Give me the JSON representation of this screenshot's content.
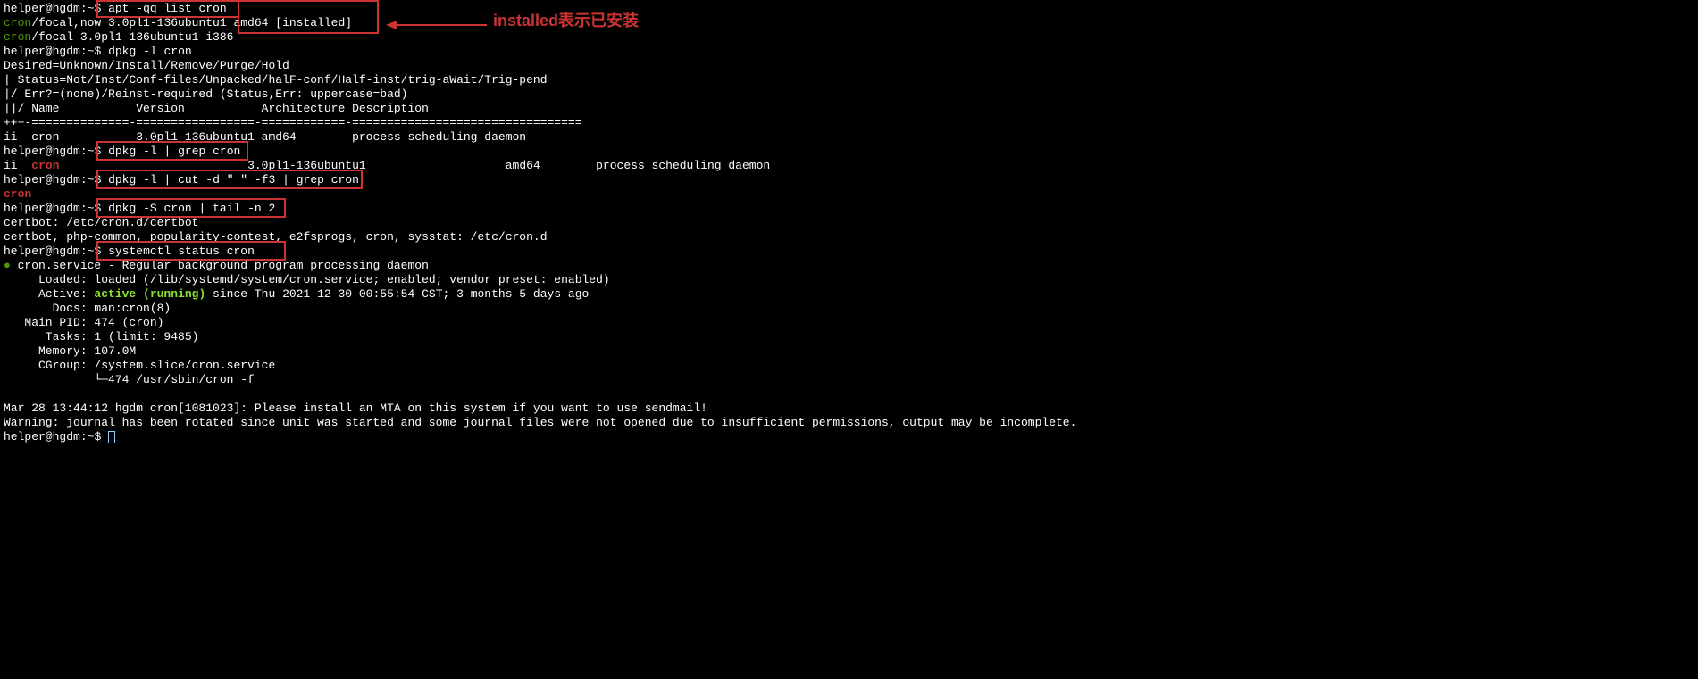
{
  "prompt": {
    "userhost": "helper@hgdm",
    "path": "~",
    "sep": ":",
    "dollar": "$"
  },
  "cmd": {
    "apt_list": "apt -qq list cron",
    "dpkg_l_cron": "dpkg -l cron",
    "dpkg_l_grep": "dpkg -l | grep cron",
    "dpkg_cut": "dpkg -l | cut -d \" \" -f3 | grep cron",
    "dpkg_S": "dpkg -S cron | tail -n 2",
    "systemctl": "systemctl status cron"
  },
  "apt": {
    "cron_focal_now": "cron",
    "focal_now_rest": "/focal,now 3.0pl1-136ubuntu1 amd64 [installed]",
    "cron_focal": "cron",
    "focal_rest": "/focal 3.0pl1-136ubuntu1 i386"
  },
  "dpkg_hdr": {
    "l1": "Desired=Unknown/Install/Remove/Purge/Hold",
    "l2": "| Status=Not/Inst/Conf-files/Unpacked/halF-conf/Half-inst/trig-aWait/Trig-pend",
    "l3": "|/ Err?=(none)/Reinst-required (Status,Err: uppercase=bad)",
    "l4": "||/ Name           Version           Architecture Description",
    "l5": "+++-==============-=================-============-=================================",
    "l6": "ii  cron           3.0pl1-136ubuntu1 amd64        process scheduling daemon"
  },
  "grep": {
    "ii": "ii  ",
    "cron": "cron",
    "rest": "                           3.0pl1-136ubuntu1                    amd64        process scheduling daemon"
  },
  "cut": {
    "cron": "cron"
  },
  "dpkgS": {
    "l1": "certbot: /etc/cron.d/certbot",
    "l2": "certbot, php-common, popularity-contest, e2fsprogs, cron, sysstat: /etc/cron.d"
  },
  "svc": {
    "bullet": "●",
    "name": " cron.service - Regular background program processing daemon",
    "loaded_label": "     Loaded: ",
    "loaded_val": "loaded (/lib/systemd/system/cron.service; enabled; vendor preset: enabled)",
    "active_label": "     Active: ",
    "active_val": "active (running)",
    "active_rest": " since Thu 2021-12-30 00:55:54 CST; 3 months 5 days ago",
    "docs": "       Docs: man:cron(8)",
    "mainpid": "   Main PID: 474 (cron)",
    "tasks": "      Tasks: 1 (limit: 9485)",
    "memory": "     Memory: 107.0M",
    "cgroup": "     CGroup: /system.slice/cron.service",
    "tree": "             └─474 /usr/sbin/cron -f"
  },
  "tail": {
    "blank": " ",
    "log": "Mar 28 13:44:12 hgdm cron[1081023]: Please install an MTA on this system if you want to use sendmail!",
    "warn": "Warning: journal has been rotated since unit was started and some journal files were not opened due to insufficient permissions, output may be incomplete."
  },
  "annot": {
    "installed": "installed",
    "installed_rest": "表示已安装"
  }
}
